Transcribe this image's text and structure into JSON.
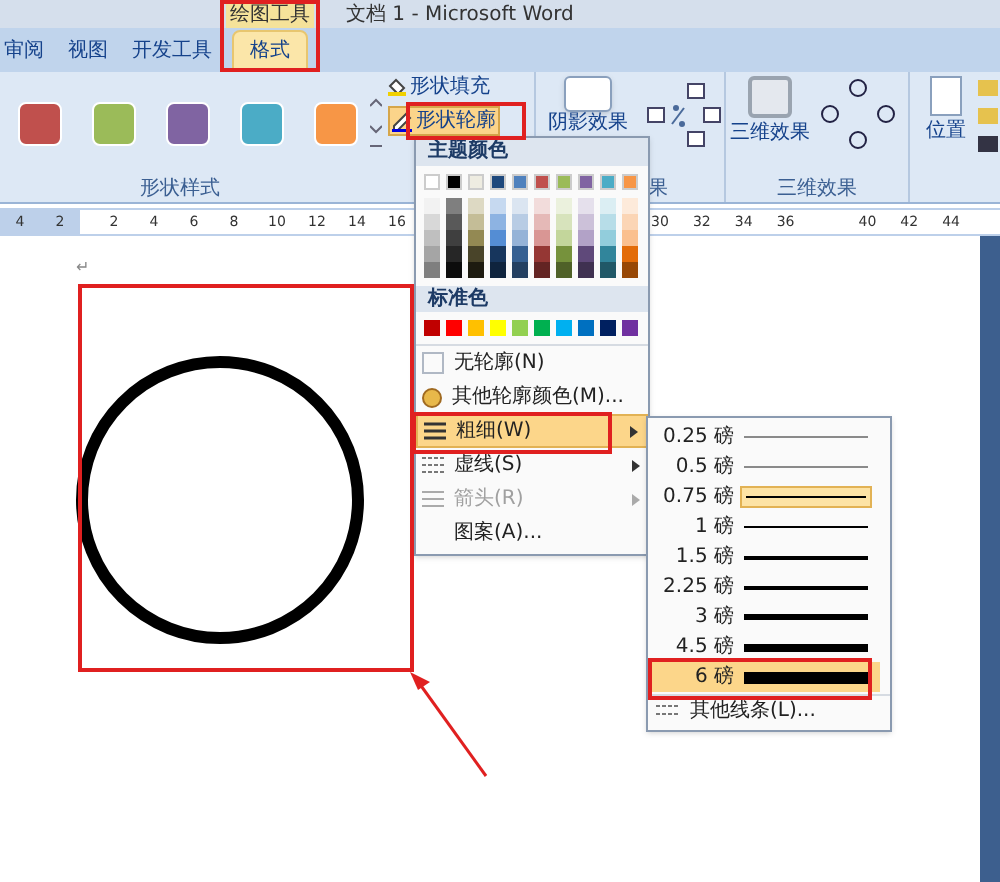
{
  "window": {
    "title": "文档 1 - Microsoft Word",
    "context_tab": "绘图工具"
  },
  "tabs": [
    {
      "label": "审阅",
      "selected": false
    },
    {
      "label": "视图",
      "selected": false
    },
    {
      "label": "开发工具",
      "selected": false
    },
    {
      "label": "格式",
      "selected": true
    }
  ],
  "ribbon": {
    "shape_styles": {
      "swatches": [
        {
          "color": "#c0504d"
        },
        {
          "color": "#9bbb59"
        },
        {
          "color": "#8064a2"
        },
        {
          "color": "#4bacc6"
        },
        {
          "color": "#f79646"
        }
      ],
      "fill_button": "形状填充",
      "outline_button": "形状轮廓",
      "group_label": "形状样式"
    },
    "shadow": {
      "button": "阴影效果",
      "group_label": "果"
    },
    "three_d": {
      "button": "三维效果",
      "group_label": "三维效果"
    },
    "arrange": {
      "button": "位置"
    }
  },
  "ruler": {
    "left_numbers": [
      "4",
      "2"
    ],
    "right_numbers": [
      "2",
      "4",
      "6",
      "8",
      "10",
      "12",
      "14",
      "16"
    ],
    "far_numbers": [
      "30",
      "32",
      "34",
      "36",
      "40",
      "42",
      "44"
    ]
  },
  "document": {
    "paragraph_mark": "↵"
  },
  "outline_menu": {
    "theme_header": "主题颜色",
    "theme_colors": [
      {
        "color": "#ffffff",
        "shades": [
          {
            "color": "#f2f2f2"
          },
          {
            "color": "#d8d8d8"
          },
          {
            "color": "#bfbfbf"
          },
          {
            "color": "#a5a5a5"
          },
          {
            "color": "#7f7f7f"
          }
        ]
      },
      {
        "color": "#000000",
        "shades": [
          {
            "color": "#7f7f7f"
          },
          {
            "color": "#595959"
          },
          {
            "color": "#3f3f3f"
          },
          {
            "color": "#262626"
          },
          {
            "color": "#0c0c0c"
          }
        ]
      },
      {
        "color": "#eeece1",
        "shades": [
          {
            "color": "#ddd9c3"
          },
          {
            "color": "#c4bd97"
          },
          {
            "color": "#938953"
          },
          {
            "color": "#494429"
          },
          {
            "color": "#1d1b10"
          }
        ]
      },
      {
        "color": "#1f497d",
        "shades": [
          {
            "color": "#c6d9f0"
          },
          {
            "color": "#8db3e2"
          },
          {
            "color": "#548dd4"
          },
          {
            "color": "#17365d"
          },
          {
            "color": "#0f243e"
          }
        ]
      },
      {
        "color": "#4f81bd",
        "shades": [
          {
            "color": "#dbe5f1"
          },
          {
            "color": "#b8cce4"
          },
          {
            "color": "#95b3d7"
          },
          {
            "color": "#366092"
          },
          {
            "color": "#244061"
          }
        ]
      },
      {
        "color": "#c0504d",
        "shades": [
          {
            "color": "#f2dcdb"
          },
          {
            "color": "#e5b9b7"
          },
          {
            "color": "#d99694"
          },
          {
            "color": "#953734"
          },
          {
            "color": "#632423"
          }
        ]
      },
      {
        "color": "#9bbb59",
        "shades": [
          {
            "color": "#ebf1dd"
          },
          {
            "color": "#d7e3bc"
          },
          {
            "color": "#c3d69b"
          },
          {
            "color": "#76923c"
          },
          {
            "color": "#4f6128"
          }
        ]
      },
      {
        "color": "#8064a2",
        "shades": [
          {
            "color": "#e5e0ec"
          },
          {
            "color": "#ccc1d9"
          },
          {
            "color": "#b2a2c7"
          },
          {
            "color": "#5f497a"
          },
          {
            "color": "#3f3151"
          }
        ]
      },
      {
        "color": "#4bacc6",
        "shades": [
          {
            "color": "#dbeef3"
          },
          {
            "color": "#b7dde8"
          },
          {
            "color": "#92cddc"
          },
          {
            "color": "#31859b"
          },
          {
            "color": "#205867"
          }
        ]
      },
      {
        "color": "#f79646",
        "shades": [
          {
            "color": "#fdeada"
          },
          {
            "color": "#fbd5b5"
          },
          {
            "color": "#fac08f"
          },
          {
            "color": "#e36c09"
          },
          {
            "color": "#974806"
          }
        ]
      }
    ],
    "standard_header": "标准色",
    "standard_colors": [
      {
        "color": "#c00000"
      },
      {
        "color": "#ff0000"
      },
      {
        "color": "#ffc000"
      },
      {
        "color": "#ffff00"
      },
      {
        "color": "#92d050"
      },
      {
        "color": "#00b050"
      },
      {
        "color": "#00b0f0"
      },
      {
        "color": "#0070c0"
      },
      {
        "color": "#002060"
      },
      {
        "color": "#7030a0"
      }
    ],
    "items": [
      {
        "label": "无轮廓(N)",
        "kind": "plain",
        "selected": false,
        "disabled": false
      },
      {
        "label": "其他轮廓颜色(M)...",
        "kind": "palette",
        "selected": false,
        "disabled": false
      },
      {
        "label": "粗细(W)",
        "kind": "weight",
        "selected": true,
        "disabled": false
      },
      {
        "label": "虚线(S)",
        "kind": "dash",
        "selected": false,
        "disabled": false
      },
      {
        "label": "箭头(R)",
        "kind": "arrow",
        "selected": false,
        "disabled": true
      },
      {
        "label": "图案(A)...",
        "kind": "pattern",
        "selected": false,
        "disabled": false
      }
    ]
  },
  "weight_menu": {
    "options": [
      {
        "label": "0.25 磅",
        "kind": "hairline",
        "current": false,
        "selected": false
      },
      {
        "label": "0.5 磅",
        "kind": "hairline",
        "current": false,
        "selected": false
      },
      {
        "label": "0.75 磅",
        "kind": "thin",
        "current": true,
        "selected": false
      },
      {
        "label": "1 磅",
        "kind": "thin",
        "current": false,
        "selected": false
      },
      {
        "label": "1.5 磅",
        "kind": "medium",
        "current": false,
        "selected": false
      },
      {
        "label": "2.25 磅",
        "kind": "medium",
        "current": false,
        "selected": false
      },
      {
        "label": "3 磅",
        "kind": "thick",
        "current": false,
        "selected": false
      },
      {
        "label": "4.5 磅",
        "kind": "heavier",
        "current": false,
        "selected": false
      },
      {
        "label": "6 磅",
        "kind": "heaviest",
        "current": false,
        "selected": true
      }
    ],
    "more": "其他线条(L)..."
  }
}
